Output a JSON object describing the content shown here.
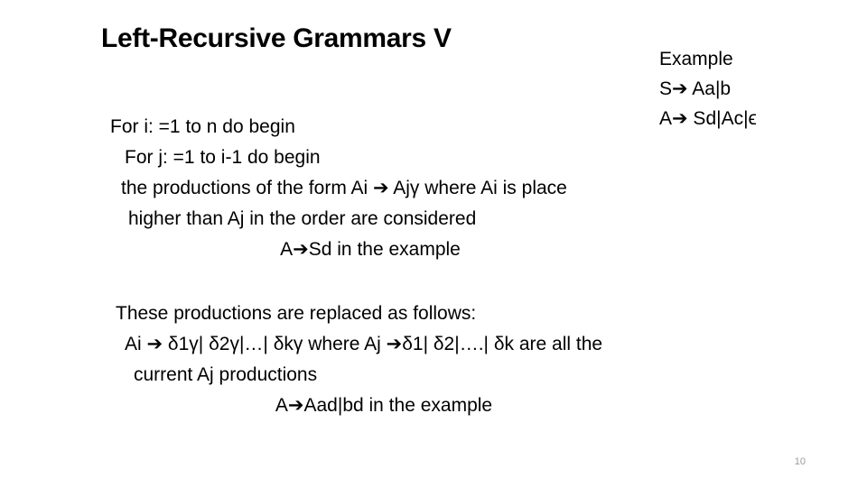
{
  "slide": {
    "title": "Left-Recursive Grammars V",
    "example": {
      "heading": "Example",
      "lines": [
        "S➔ Aa|b",
        "A➔ Sd|Ac|ϵ"
      ]
    },
    "algorithm": {
      "lines": [
        "For i: =1 to n do begin",
        "For j: =1 to i-1 do begin",
        "the productions of the form Ai ➔ Ajγ  where Ai is place",
        "higher than Aj in the order are considered",
        "A➔Sd in the example"
      ]
    },
    "replacement": {
      "lines": [
        "These productions are replaced as follows:",
        "Ai ➔ δ1γ| δ2γ|…| δkγ where Aj ➔δ1| δ2|….| δk are all the",
        "current Aj productions",
        "A➔Aad|bd in the example"
      ]
    },
    "page_number": "10"
  }
}
